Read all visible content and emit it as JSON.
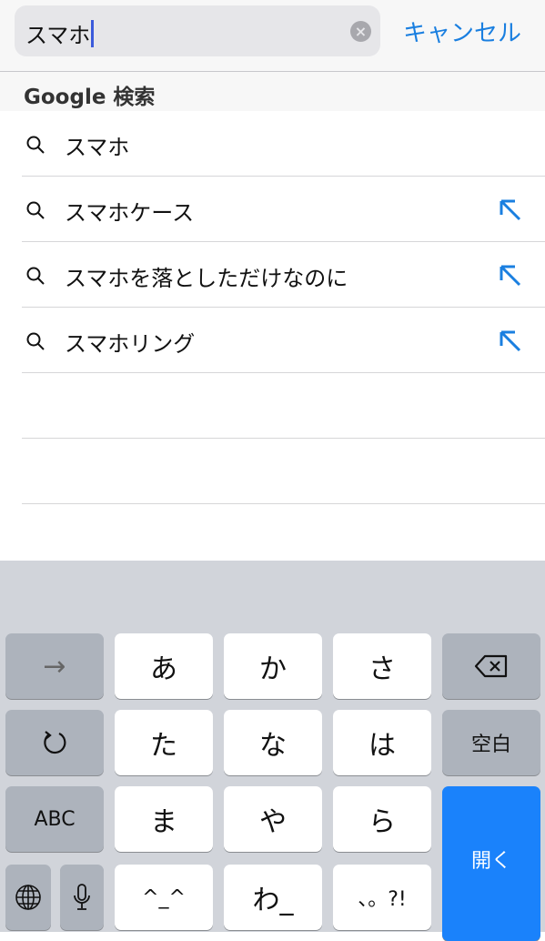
{
  "search": {
    "value": "スマホ",
    "cancel_label": "キャンセル"
  },
  "section_title": "Google 検索",
  "suggestions": [
    {
      "text": "スマホ",
      "has_arrow": false
    },
    {
      "text": "スマホケース",
      "has_arrow": true
    },
    {
      "text": "スマホを落としただけなのに",
      "has_arrow": true
    },
    {
      "text": "スマホリング",
      "has_arrow": true
    }
  ],
  "keyboard": {
    "keys": {
      "arrow": "→",
      "a": "あ",
      "ka": "か",
      "sa": "さ",
      "ta": "た",
      "na": "な",
      "ha": "は",
      "space": "空白",
      "abc": "ABC",
      "ma": "ま",
      "ya": "や",
      "ra": "ら",
      "kaomoji": "^_^",
      "wa": "わ_",
      "punct": "、。?!",
      "enter": "開く"
    },
    "accent": "#1a82fb"
  },
  "colors": {
    "link": "#1a7fe0"
  }
}
